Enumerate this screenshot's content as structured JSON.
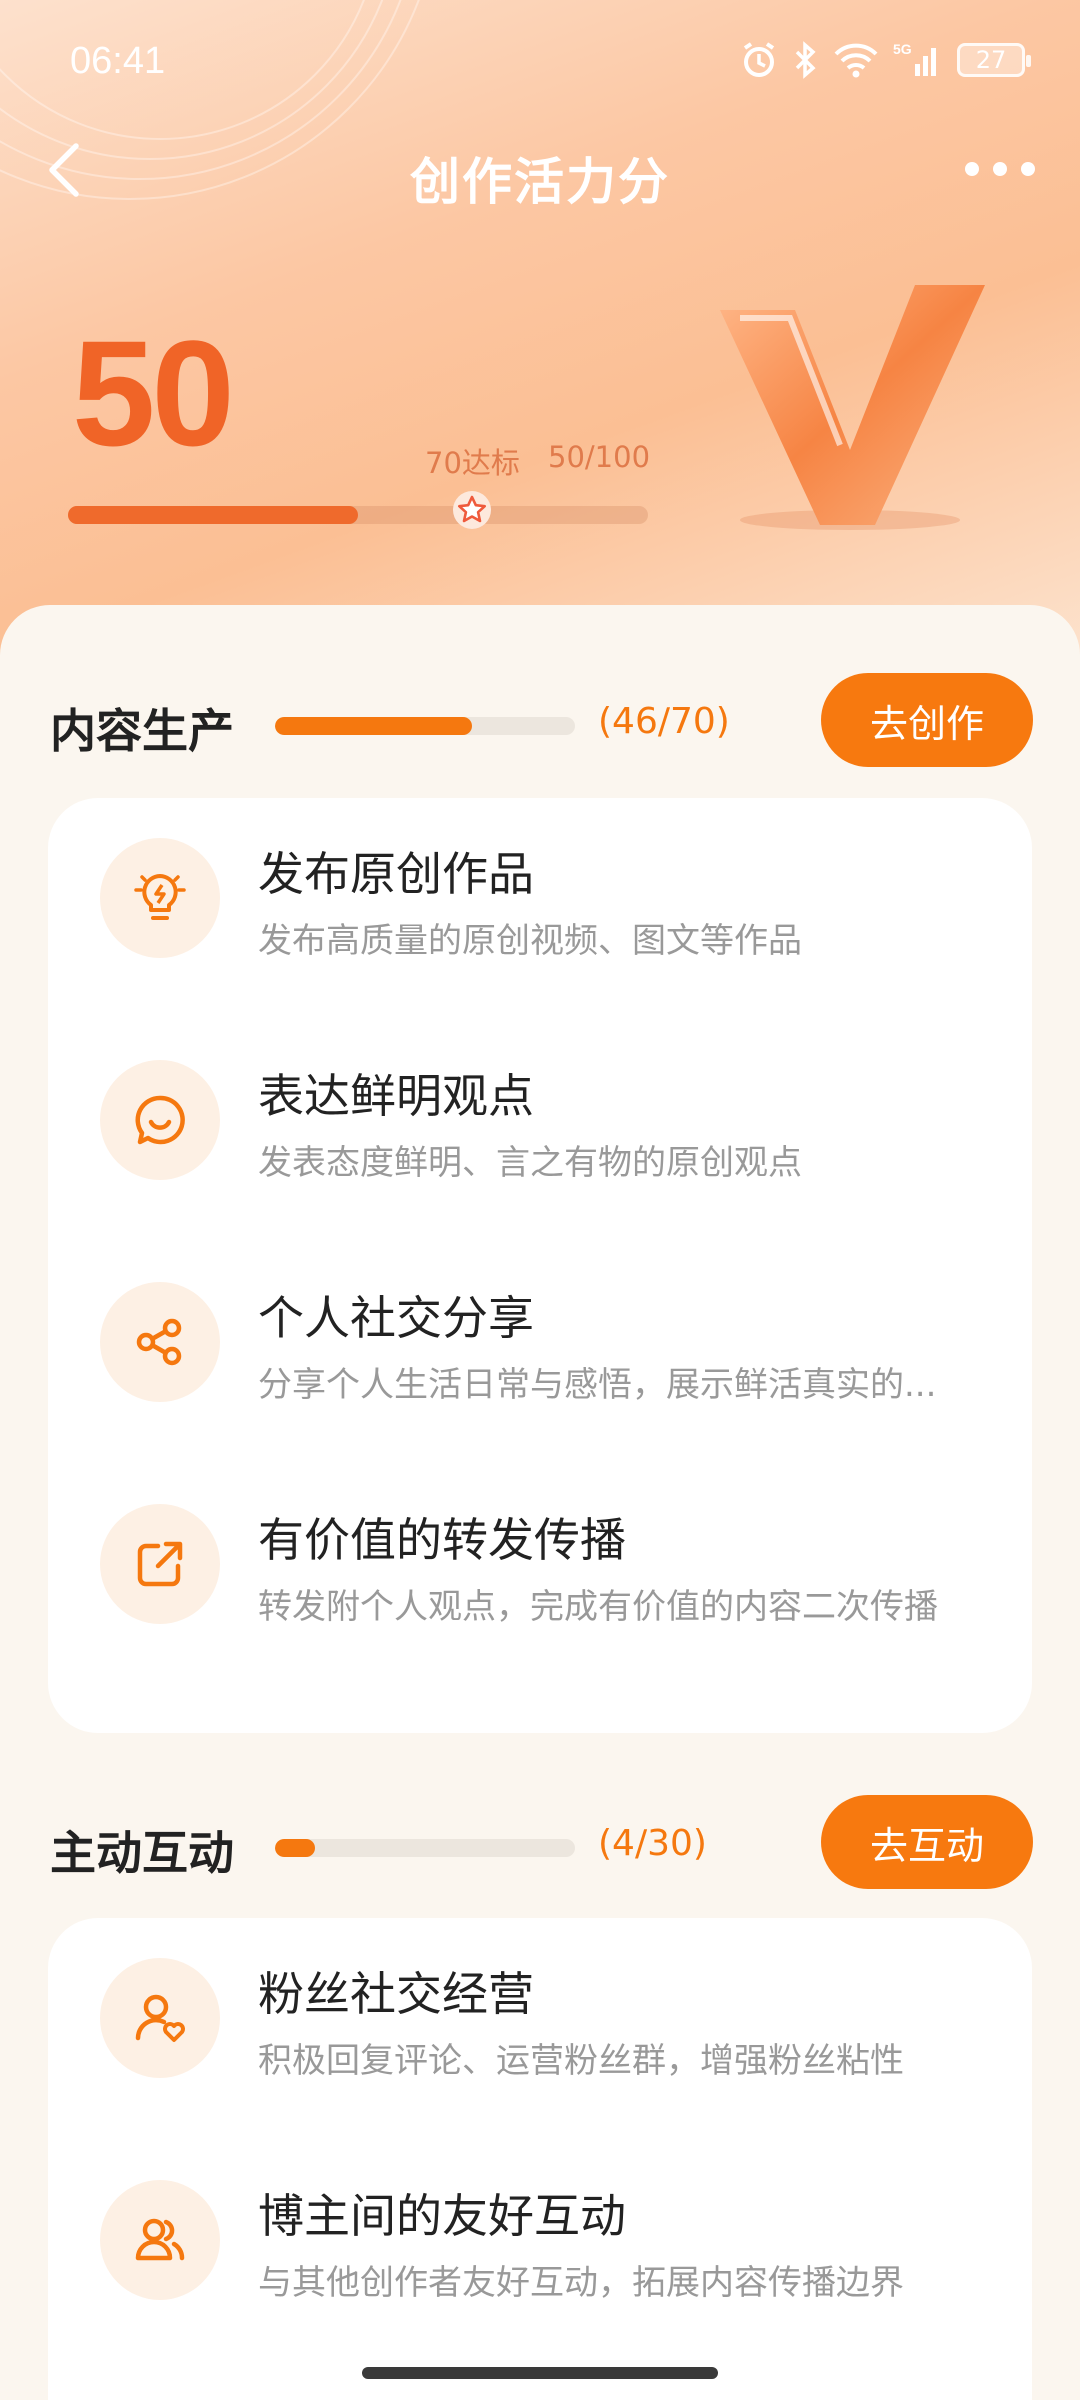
{
  "status_bar": {
    "time": "06:41",
    "battery": "27",
    "network": "5G"
  },
  "nav": {
    "title": "创作活力分",
    "back_icon": "chevron-left-icon",
    "more_icon": "more-dots-icon"
  },
  "score_panel": {
    "score": "50",
    "target_label": "70达标",
    "progress_label": "50/100",
    "progress_fraction": 0.5,
    "target_fraction": 0.7
  },
  "sections": [
    {
      "title": "内容生产",
      "count": "(46/70)",
      "fraction": 0.657,
      "button": "去创作",
      "items": [
        {
          "icon": "lightbulb-icon",
          "title": "发布原创作品",
          "desc": "发布高质量的原创视频、图文等作品"
        },
        {
          "icon": "chat-smile-icon",
          "title": "表达鲜明观点",
          "desc": "发表态度鲜明、言之有物的原创观点"
        },
        {
          "icon": "share-icon",
          "title": "个人社交分享",
          "desc": "分享个人生活日常与感悟，展示鲜活真实的..."
        },
        {
          "icon": "forward-icon",
          "title": "有价值的转发传播",
          "desc": "转发附个人观点，完成有价值的内容二次传播"
        }
      ]
    },
    {
      "title": "主动互动",
      "count": "(4/30)",
      "fraction": 0.133,
      "button": "去互动",
      "items": [
        {
          "icon": "fan-heart-icon",
          "title": "粉丝社交经营",
          "desc": "积极回复评论、运营粉丝群，增强粉丝粘性"
        },
        {
          "icon": "users-icon",
          "title": "博主间的友好互动",
          "desc": "与其他创作者友好互动，拓展内容传播边界"
        }
      ]
    }
  ],
  "colors": {
    "accent": "#f7790f",
    "score": "#f06427",
    "background": "#fbf6ef"
  }
}
